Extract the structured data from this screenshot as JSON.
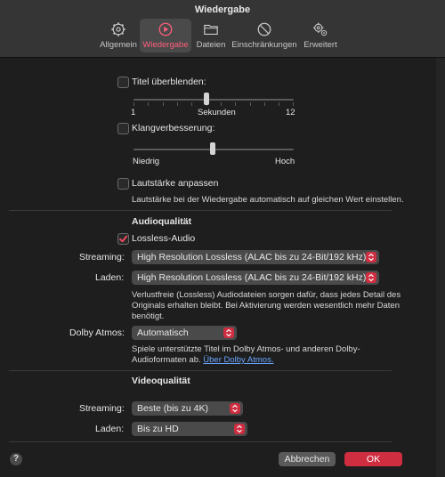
{
  "window": {
    "title": "Wiedergabe"
  },
  "tabs": [
    {
      "label": "Allgemein",
      "icon": "gear-icon"
    },
    {
      "label": "Wiedergabe",
      "icon": "play-circle-icon",
      "active": true
    },
    {
      "label": "Dateien",
      "icon": "folder-icon"
    },
    {
      "label": "Einschränkungen",
      "icon": "prohibited-icon"
    },
    {
      "label": "Erweitert",
      "icon": "gears-icon"
    }
  ],
  "crossfade": {
    "label": "Titel überblenden:",
    "checked": false,
    "min_label": "1",
    "mid_label": "Sekunden",
    "max_label": "12",
    "value": 6
  },
  "sound_enhancer": {
    "label": "Klangverbesserung:",
    "checked": false,
    "low_label": "Niedrig",
    "high_label": "Hoch",
    "value": 0.5
  },
  "sound_check": {
    "label": "Lautstärke anpassen",
    "checked": false,
    "description": "Lautstärke bei der Wiedergabe automatisch auf gleichen Wert einstellen."
  },
  "audio_quality": {
    "heading": "Audioqualität",
    "lossless_label": "Lossless-Audio",
    "lossless_checked": true,
    "streaming_label": "Streaming:",
    "streaming_value": "High Resolution Lossless (ALAC bis zu 24-Bit/192 kHz)",
    "download_label": "Laden:",
    "download_value": "High Resolution Lossless (ALAC bis zu 24-Bit/192 kHz)",
    "description_line1": "Verlustfreie (Lossless) Audiodateien sorgen dafür, dass jedes Detail des",
    "description_line2": "Originals erhalten bleibt. Bei Aktivierung werden wesentlich mehr Daten",
    "description_line3": "benötigt.",
    "dolby_label": "Dolby Atmos:",
    "dolby_value": "Automatisch",
    "dolby_desc_line1": "Spiele unterstützte Titel im Dolby Atmos- und anderen Dolby-",
    "dolby_desc_line2": "Audioformaten ab.",
    "dolby_link": "Über Dolby Atmos."
  },
  "video_quality": {
    "heading": "Videoqualität",
    "streaming_label": "Streaming:",
    "streaming_value": "Beste (bis zu 4K)",
    "download_label": "Laden:",
    "download_value": "Bis zu HD"
  },
  "footer": {
    "help": "?",
    "cancel": "Abbrechen",
    "ok": "OK"
  },
  "colors": {
    "accent": "#ff5f7a",
    "ok_button": "#cf2e41",
    "background": "#1e1e1e"
  }
}
